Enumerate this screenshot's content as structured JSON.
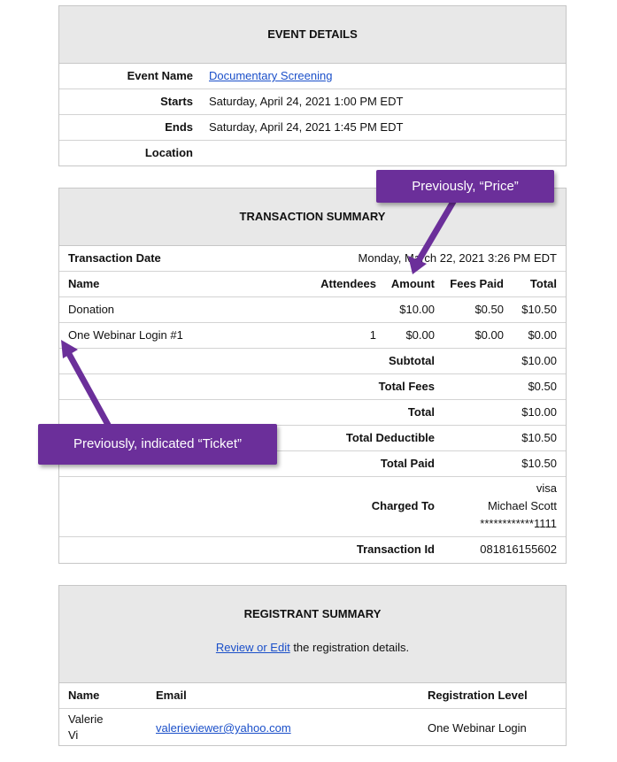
{
  "event": {
    "title": "EVENT DETAILS",
    "rows": [
      {
        "label": "Event Name",
        "value": "Documentary Screening"
      },
      {
        "label": "Starts",
        "value": "Saturday, April 24, 2021 1:00 PM EDT"
      },
      {
        "label": "Ends",
        "value": "Saturday, April 24, 2021 1:45 PM EDT"
      },
      {
        "label": "Location",
        "value": ""
      }
    ]
  },
  "transaction": {
    "title": "TRANSACTION SUMMARY",
    "date_label": "Transaction Date",
    "date_value": "Monday, March 22, 2021 3:26 PM EDT",
    "columns": [
      "Name",
      "Attendees",
      "Amount",
      "Fees Paid",
      "Total"
    ],
    "items": [
      {
        "name": "Donation",
        "attendees": "",
        "amount": "$10.00",
        "fees": "$0.50",
        "total": "$10.50"
      },
      {
        "name": "One Webinar Login #1",
        "attendees": "1",
        "amount": "$0.00",
        "fees": "$0.00",
        "total": "$0.00"
      }
    ],
    "summary": [
      {
        "label": "Subtotal",
        "value": "$10.00"
      },
      {
        "label": "Total Fees",
        "value": "$0.50"
      },
      {
        "label": "Total",
        "value": "$10.00"
      },
      {
        "label": "Total Deductible",
        "value": "$10.50"
      },
      {
        "label": "Total Paid",
        "value": "$10.50"
      }
    ],
    "charged_label": "Charged To",
    "charged_lines": [
      "visa",
      "Michael Scott",
      "************1111"
    ],
    "txid_label": "Transaction Id",
    "txid_value": "081816155602"
  },
  "registrant": {
    "title": "REGISTRANT SUMMARY",
    "review_link": "Review or Edit",
    "review_text": " the registration details.",
    "columns": [
      "Name",
      "Email",
      "Registration Level"
    ],
    "row": {
      "name_line1": "Valerie",
      "name_line2": "Vi",
      "email": "valerieviewer@yahoo.com",
      "level": "One Webinar Login"
    }
  },
  "callouts": {
    "price": "Previously, “Price”",
    "ticket": "Previously, indicated “Ticket”",
    "color": "#6b2f9a"
  }
}
